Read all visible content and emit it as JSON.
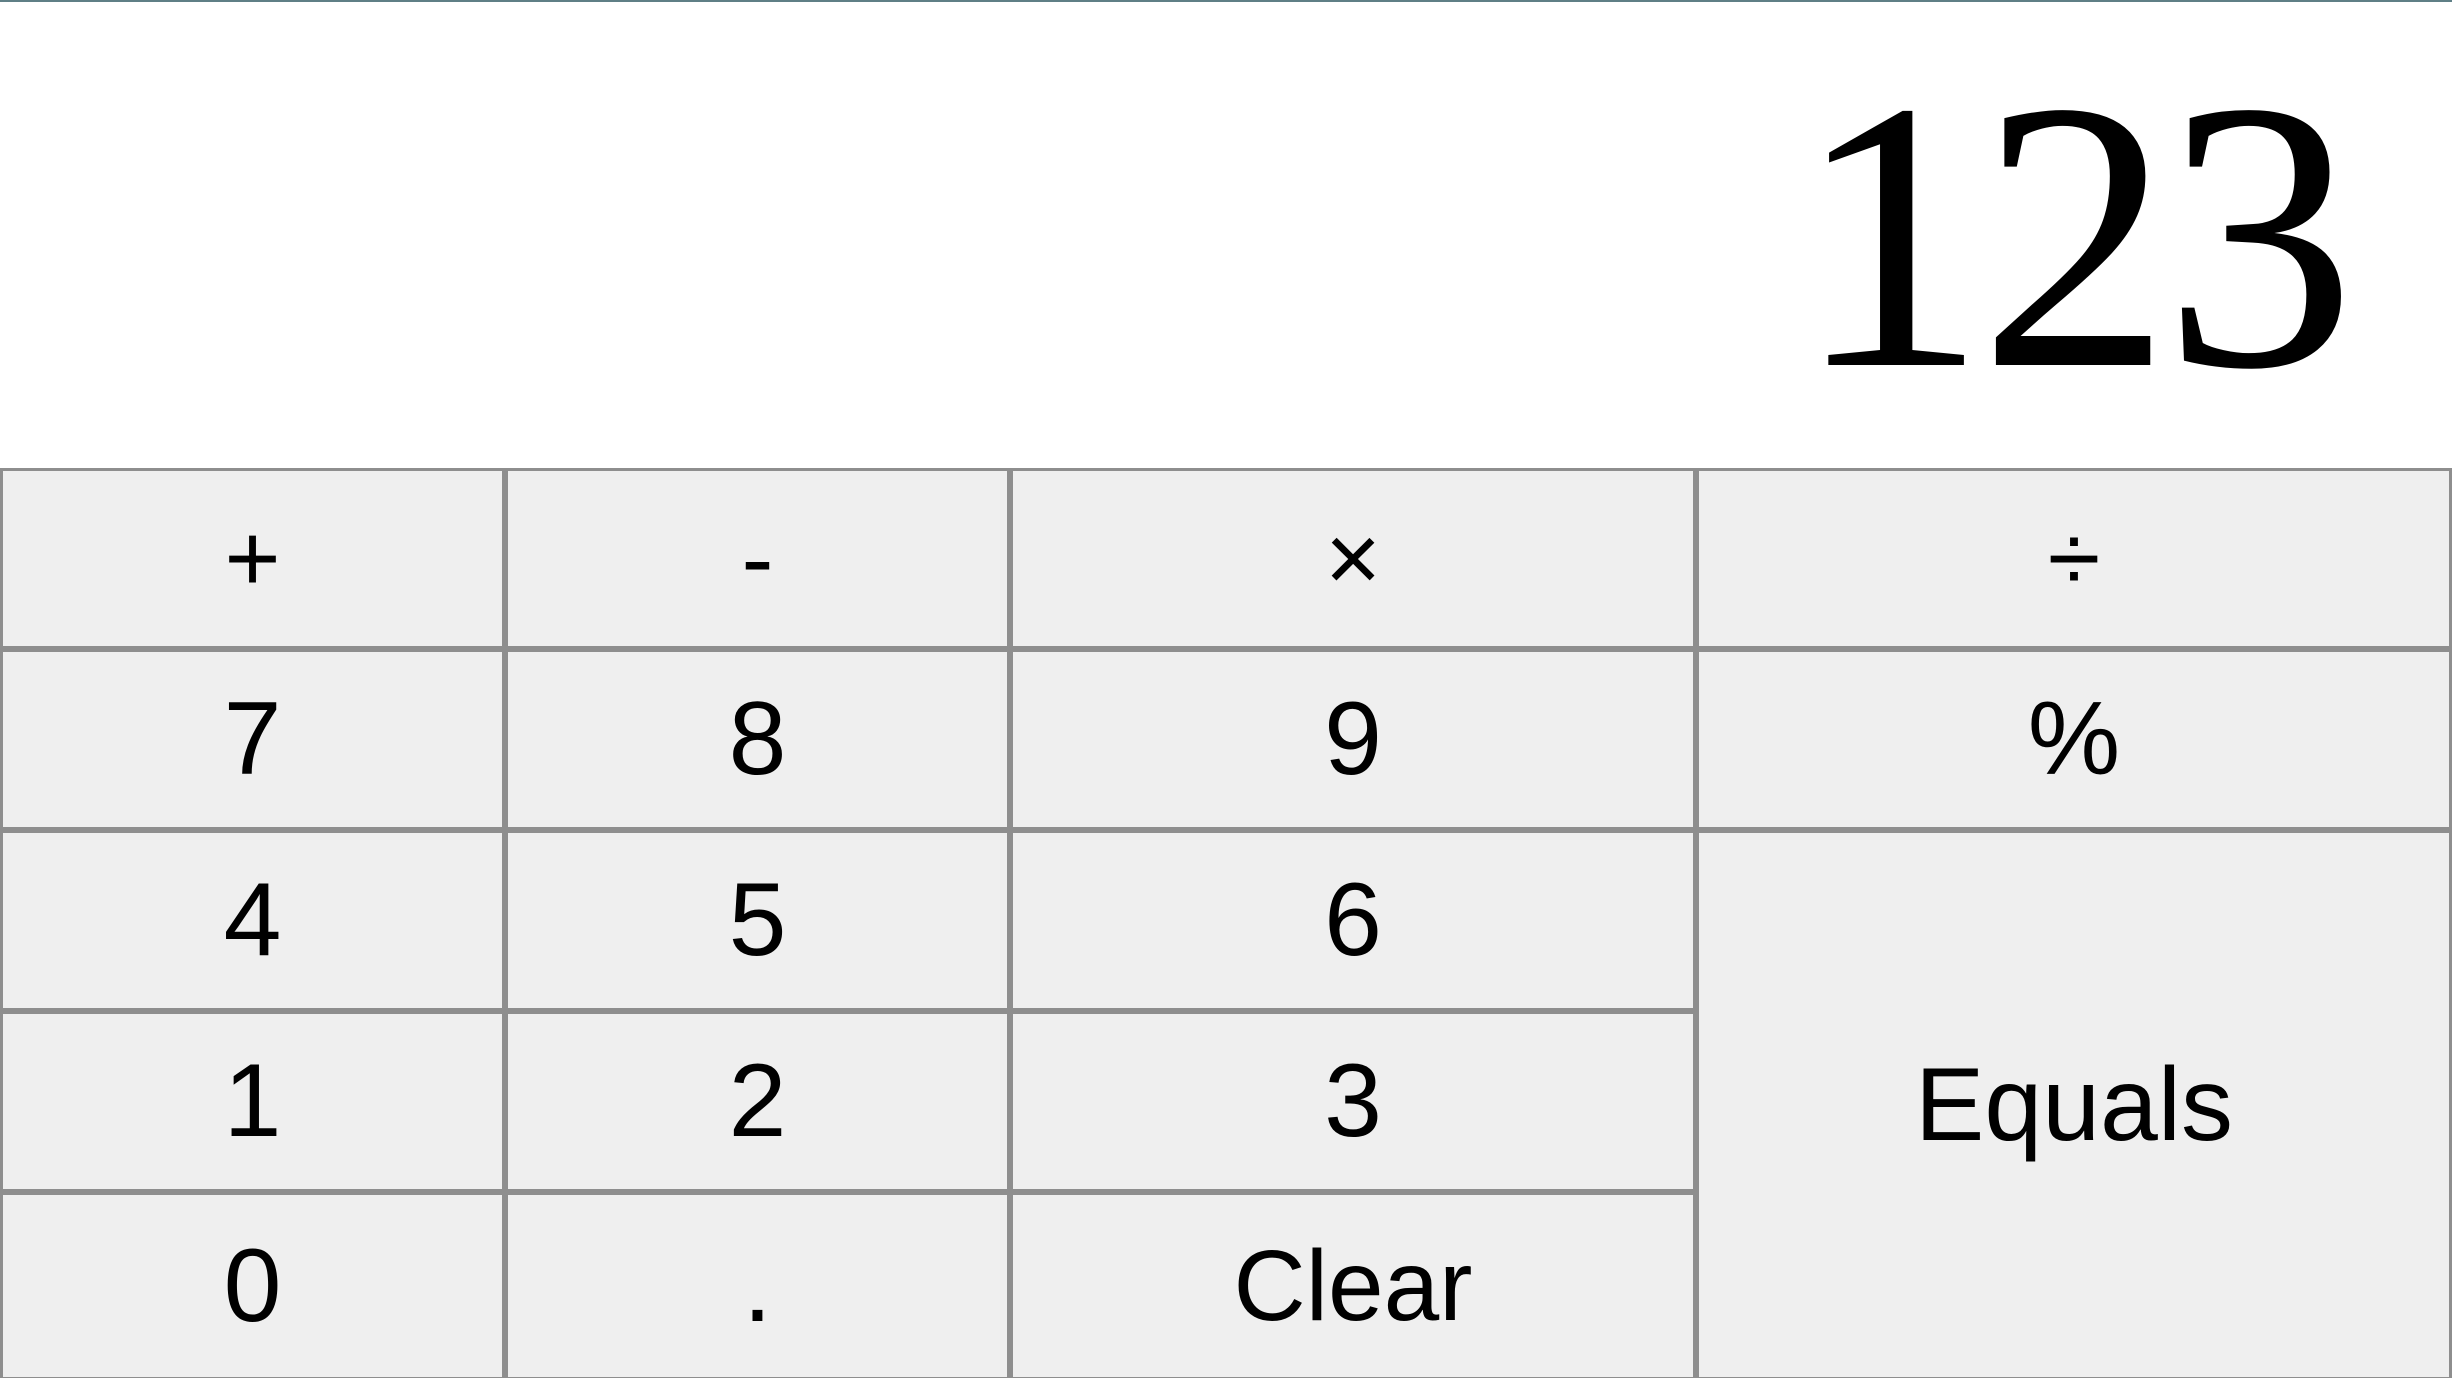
{
  "display": {
    "value": "123"
  },
  "keys": {
    "row1": [
      "+",
      "-",
      "×",
      "÷"
    ],
    "row2": [
      "7",
      "8",
      "9",
      "%"
    ],
    "row3": [
      "4",
      "5",
      "6"
    ],
    "row4": [
      "1",
      "2",
      "3"
    ],
    "row5": [
      "0",
      ".",
      "Clear"
    ],
    "equals": "Equals"
  }
}
